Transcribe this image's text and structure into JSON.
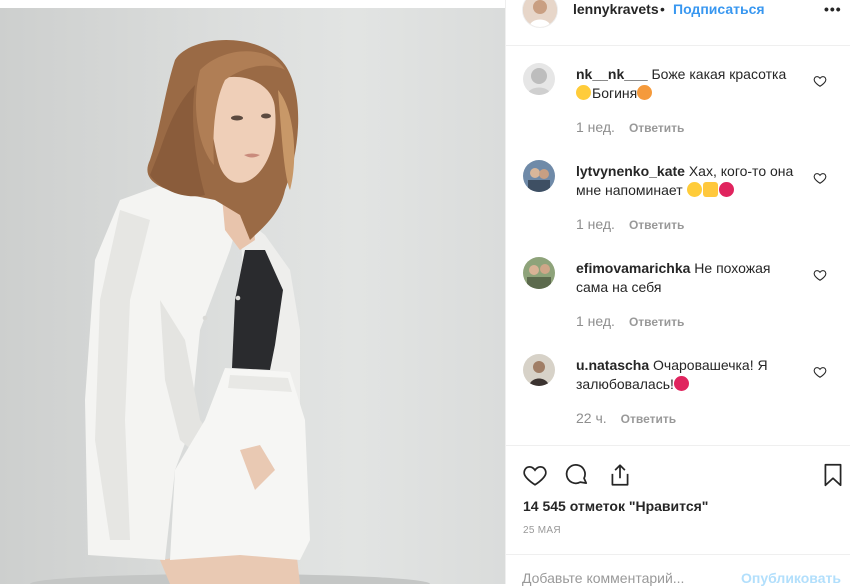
{
  "post": {
    "username": "lennykravets",
    "separator": "•",
    "follow_label": "Подписаться",
    "more_icon": "more-horizontal-icon",
    "more_label": "•••"
  },
  "comments": [
    {
      "username": "nk__nk___",
      "text": " Боже какая красотка ",
      "text2": "Богиня",
      "time": "1 нед.",
      "reply": "Ответить"
    },
    {
      "username": "lytvynenko_kate",
      "text": " Хах, кого-то она мне напоминает ",
      "time": "1 нед.",
      "reply": "Ответить"
    },
    {
      "username": "efimovamarichka",
      "text": " Не похожая сама на себя",
      "time": "1 нед.",
      "reply": "Ответить"
    },
    {
      "username": "u.natascha",
      "text": " Очаровашечка! Я залюбовалась!",
      "time": "22 ч.",
      "reply": "Ответить"
    }
  ],
  "actions": {
    "like_icon": "heart-icon",
    "comment_icon": "comment-icon",
    "share_icon": "share-icon",
    "save_icon": "bookmark-icon"
  },
  "likes_text": "14 545 отметок \"Нравится\"",
  "date": "25 мая",
  "comment_box": {
    "placeholder": "Добавьте комментарий...",
    "publish_label": "Опубликовать"
  },
  "colors": {
    "link_blue": "#3897f0",
    "publish_disabled": "#b2dffc",
    "meta_gray": "#999999"
  }
}
